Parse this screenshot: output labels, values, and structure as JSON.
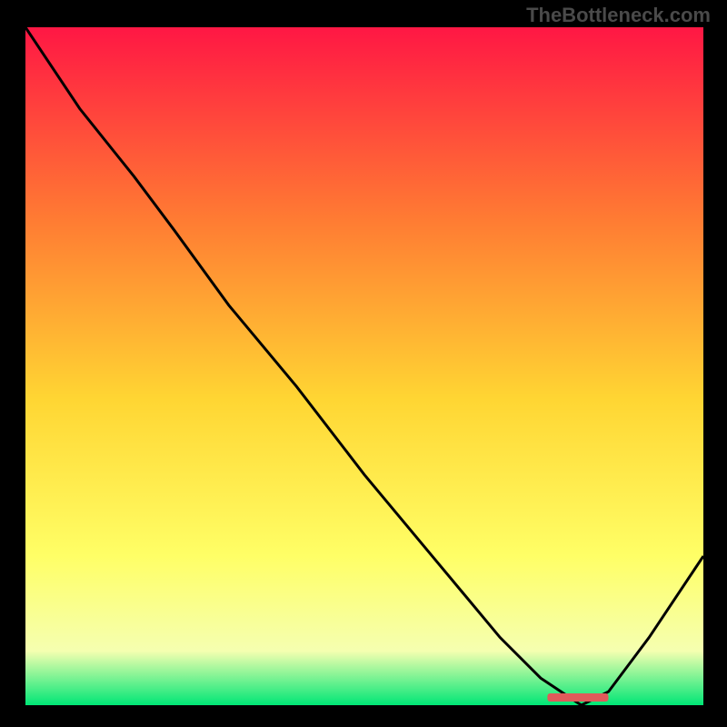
{
  "watermark": "TheBottleneck.com",
  "colors": {
    "gradient_top": "#ff1744",
    "gradient_mid_upper": "#ff7a33",
    "gradient_mid": "#ffd633",
    "gradient_mid_lower": "#ffff66",
    "gradient_lower": "#f5ffb0",
    "gradient_bottom": "#00e676",
    "line": "#000000",
    "marker": "#e05a5a",
    "background": "#000000"
  },
  "chart_data": {
    "type": "line",
    "title": "",
    "xlabel": "",
    "ylabel": "",
    "xlim": [
      0,
      100
    ],
    "ylim": [
      0,
      100
    ],
    "x": [
      0,
      8,
      16,
      22,
      30,
      40,
      50,
      60,
      70,
      76,
      82,
      86,
      92,
      100
    ],
    "values": [
      100,
      88,
      78,
      70,
      59,
      47,
      34,
      22,
      10,
      4,
      0,
      2,
      10,
      22
    ],
    "marker_range_x": [
      77,
      86
    ],
    "marker_y": 1.2,
    "annotations": []
  }
}
